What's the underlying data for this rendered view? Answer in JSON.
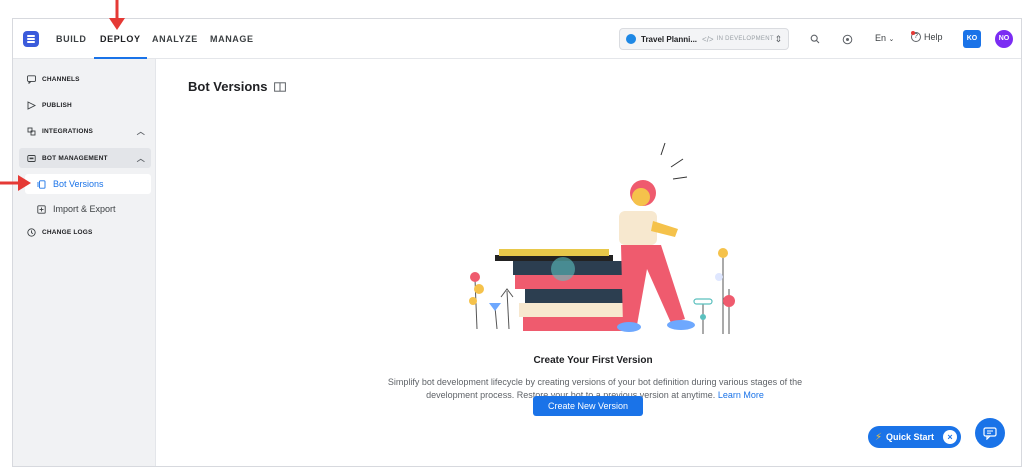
{
  "nav": {
    "tabs": [
      {
        "label": "BUILD"
      },
      {
        "label": "DEPLOY"
      },
      {
        "label": "ANALYZE"
      },
      {
        "label": "MANAGE"
      }
    ],
    "active_tab": "DEPLOY"
  },
  "bot_selector": {
    "name": "Travel Planni...",
    "code_icon": "</>",
    "status": "IN DEVELOPMENT"
  },
  "header": {
    "language": "En",
    "help_label": "Help",
    "user_initials_1": "KO",
    "user_initials_2": "NO"
  },
  "sidebar": {
    "items": [
      {
        "label": "CHANNELS",
        "icon": "chat-icon"
      },
      {
        "label": "PUBLISH",
        "icon": "send-icon"
      },
      {
        "label": "INTEGRATIONS",
        "icon": "plug-icon"
      },
      {
        "label": "BOT MANAGEMENT",
        "icon": "bot-icon"
      },
      {
        "label": "CHANGE LOGS",
        "icon": "clock-icon"
      }
    ],
    "sub_items": [
      {
        "label": "Bot Versions",
        "icon": "versions-icon",
        "active": true
      },
      {
        "label": "Import & Export",
        "icon": "import-icon",
        "active": false
      }
    ]
  },
  "main": {
    "page_title": "Bot Versions",
    "empty_title": "Create Your First Version",
    "empty_desc": "Simplify bot development lifecycle by creating versions of your bot definition during various stages of the development process. Restore your bot to a previous version at anytime.",
    "learn_more": "Learn More",
    "create_button": "Create New Version"
  },
  "widgets": {
    "quick_start": "Quick Start"
  },
  "colors": {
    "accent": "#1a73e8",
    "annotation_arrow": "#e53935",
    "sidebar_bg": "#f1f2f4"
  }
}
